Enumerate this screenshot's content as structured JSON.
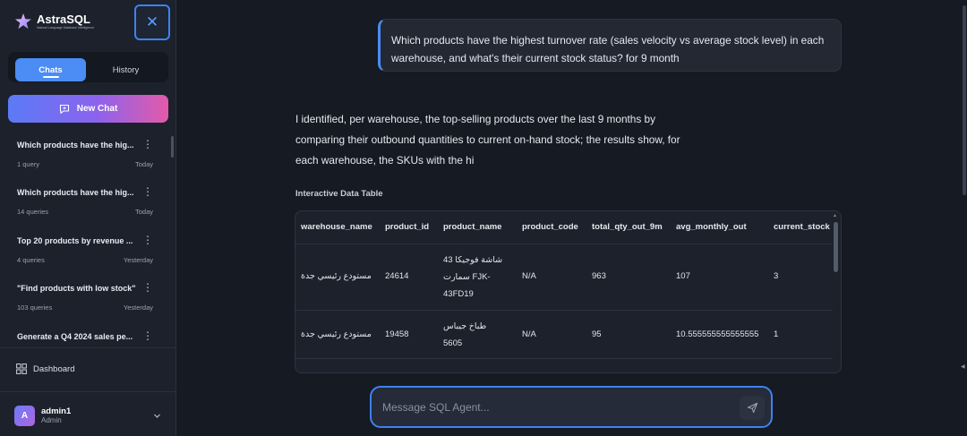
{
  "app": {
    "logo_title": "AstraSQL",
    "logo_subtitle": "Natural Language Database Intelligence",
    "close_icon": "close-icon"
  },
  "sidebar": {
    "tabs": [
      {
        "label": "Chats",
        "active": true
      },
      {
        "label": "History",
        "active": false
      }
    ],
    "new_chat_label": "New Chat",
    "chats": [
      {
        "title": "Which products have the hig...",
        "count": "1 query",
        "when": "Today"
      },
      {
        "title": "Which products have the hig...",
        "count": "14 queries",
        "when": "Today"
      },
      {
        "title": "Top 20 products by revenue ...",
        "count": "4 queries",
        "when": "Yesterday"
      },
      {
        "title": "\"Find products with low stock\"",
        "count": "103 queries",
        "when": "Yesterday"
      },
      {
        "title": "Generate a Q4 2024 sales pe...",
        "count": "",
        "when": ""
      }
    ],
    "more_icon": "⋮",
    "dashboard_label": "Dashboard",
    "user": {
      "initial": "A",
      "name": "admin1",
      "role": "Admin"
    }
  },
  "conversation": {
    "user_message": "Which products have the highest turnover rate (sales velocity vs average stock level) in each warehouse, and what's their current stock status? for 9 month",
    "assistant_reply": "I identified, per warehouse, the top-selling products over the last 9 months by comparing their outbound quantities to current on-hand stock; the results show, for each warehouse, the SKUs with the hi",
    "table_caption": "Interactive Data Table",
    "table": {
      "columns": [
        "warehouse_name",
        "product_id",
        "product_name",
        "product_code",
        "total_qty_out_9m",
        "avg_monthly_out",
        "current_stock"
      ],
      "rows": [
        {
          "warehouse_name": "مستودع رئيسي جدة",
          "product_id": "24614",
          "product_name": "شاشة فوجيكا 43 سمارت FJK-43FD19",
          "product_code": "N/A",
          "total_qty_out_9m": "963",
          "avg_monthly_out": "107",
          "current_stock": "3"
        },
        {
          "warehouse_name": "مستودع رئيسي جدة",
          "product_id": "19458",
          "product_name": "طباخ جيباس 5605",
          "product_code": "N/A",
          "total_qty_out_9m": "95",
          "avg_monthly_out": "10.555555555555555",
          "current_stock": "1"
        }
      ]
    }
  },
  "composer": {
    "placeholder": "Message SQL Agent..."
  },
  "colors": {
    "accent": "#4b8cf5",
    "gradient_start": "#5b7bf6",
    "gradient_end": "#e45aa8",
    "background": "#161a23",
    "sidebar": "#1c212c"
  }
}
